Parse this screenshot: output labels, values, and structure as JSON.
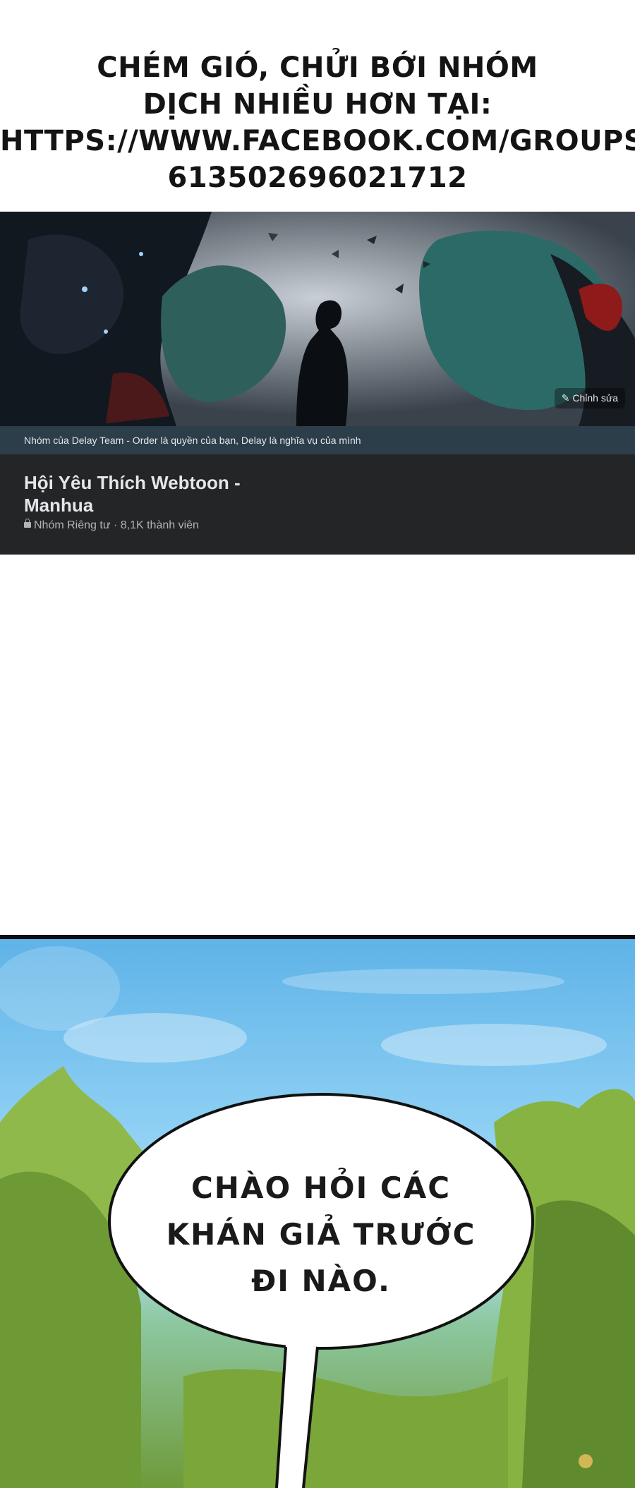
{
  "promo": {
    "line1": "CHÉM GIÓ, CHỬI BỚI NHÓM",
    "line2": "DỊCH NHIỀU HƠN TẠI:",
    "line3": "HTTPS://WWW.FACEBOOK.COM/GROUPS/",
    "line4": "613502696021712"
  },
  "group": {
    "edit_label": "Chỉnh sửa",
    "description": "Nhóm của Delay Team - Order là quyền của bạn, Delay là nghĩa vụ của mình",
    "name": "Hội Yêu Thích Webtoon - Manhua",
    "meta": "Nhóm Riêng tư · 8,1K thành viên"
  },
  "panel": {
    "speech_line1": "CHÀO HỎI CÁC",
    "speech_line2": "KHÁN GIẢ TRƯỚC",
    "speech_line3": "ĐI NÀO."
  },
  "colors": {
    "card_bg": "#242526",
    "desc_bar": "#2c3e4a",
    "sky": "#5fb3e8",
    "foliage": "#6f9a3a"
  }
}
